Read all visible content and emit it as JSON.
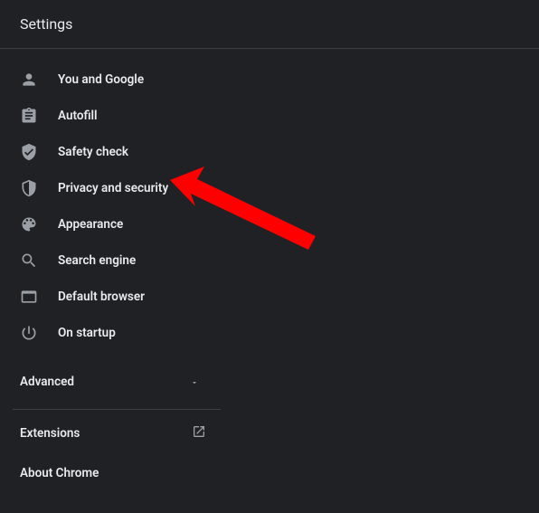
{
  "header": {
    "title": "Settings"
  },
  "sidebar": {
    "items": [
      {
        "label": "You and Google"
      },
      {
        "label": "Autofill"
      },
      {
        "label": "Safety check"
      },
      {
        "label": "Privacy and security"
      },
      {
        "label": "Appearance"
      },
      {
        "label": "Search engine"
      },
      {
        "label": "Default browser"
      },
      {
        "label": "On startup"
      }
    ],
    "advanced_label": "Advanced",
    "extensions_label": "Extensions",
    "about_label": "About Chrome"
  }
}
